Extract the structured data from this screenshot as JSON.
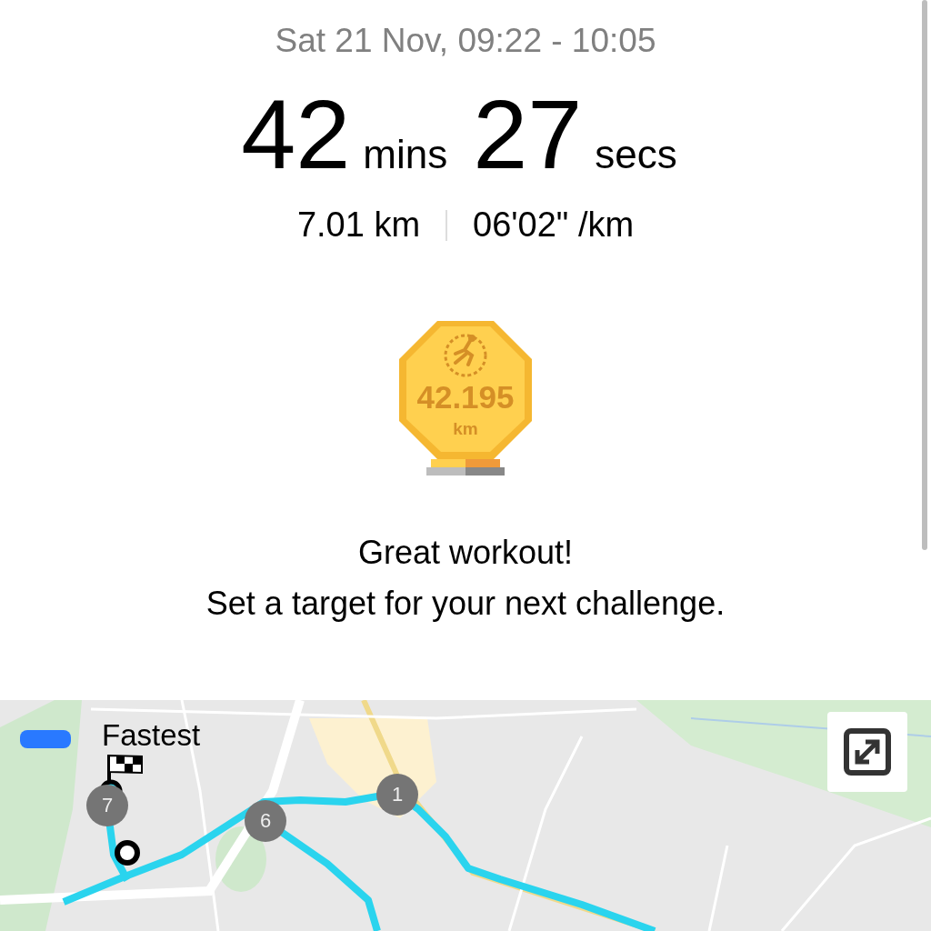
{
  "workout": {
    "date": "Sat 21 Nov, 09:22 - 10:05",
    "duration": [
      {
        "value": "42",
        "unit": "mins"
      },
      {
        "value": "27",
        "unit": "secs"
      }
    ],
    "distance": "7.01 km",
    "pace": "06'02\" /km"
  },
  "badge": {
    "value": "42.195",
    "unit": "km"
  },
  "messages": [
    "Great workout!",
    "Set a target for your next challenge."
  ],
  "map": {
    "legend": {
      "label": "Fastest",
      "color": "#2979ff"
    },
    "markers": [
      {
        "label": "7"
      },
      {
        "label": "6"
      },
      {
        "label": "1"
      }
    ]
  }
}
